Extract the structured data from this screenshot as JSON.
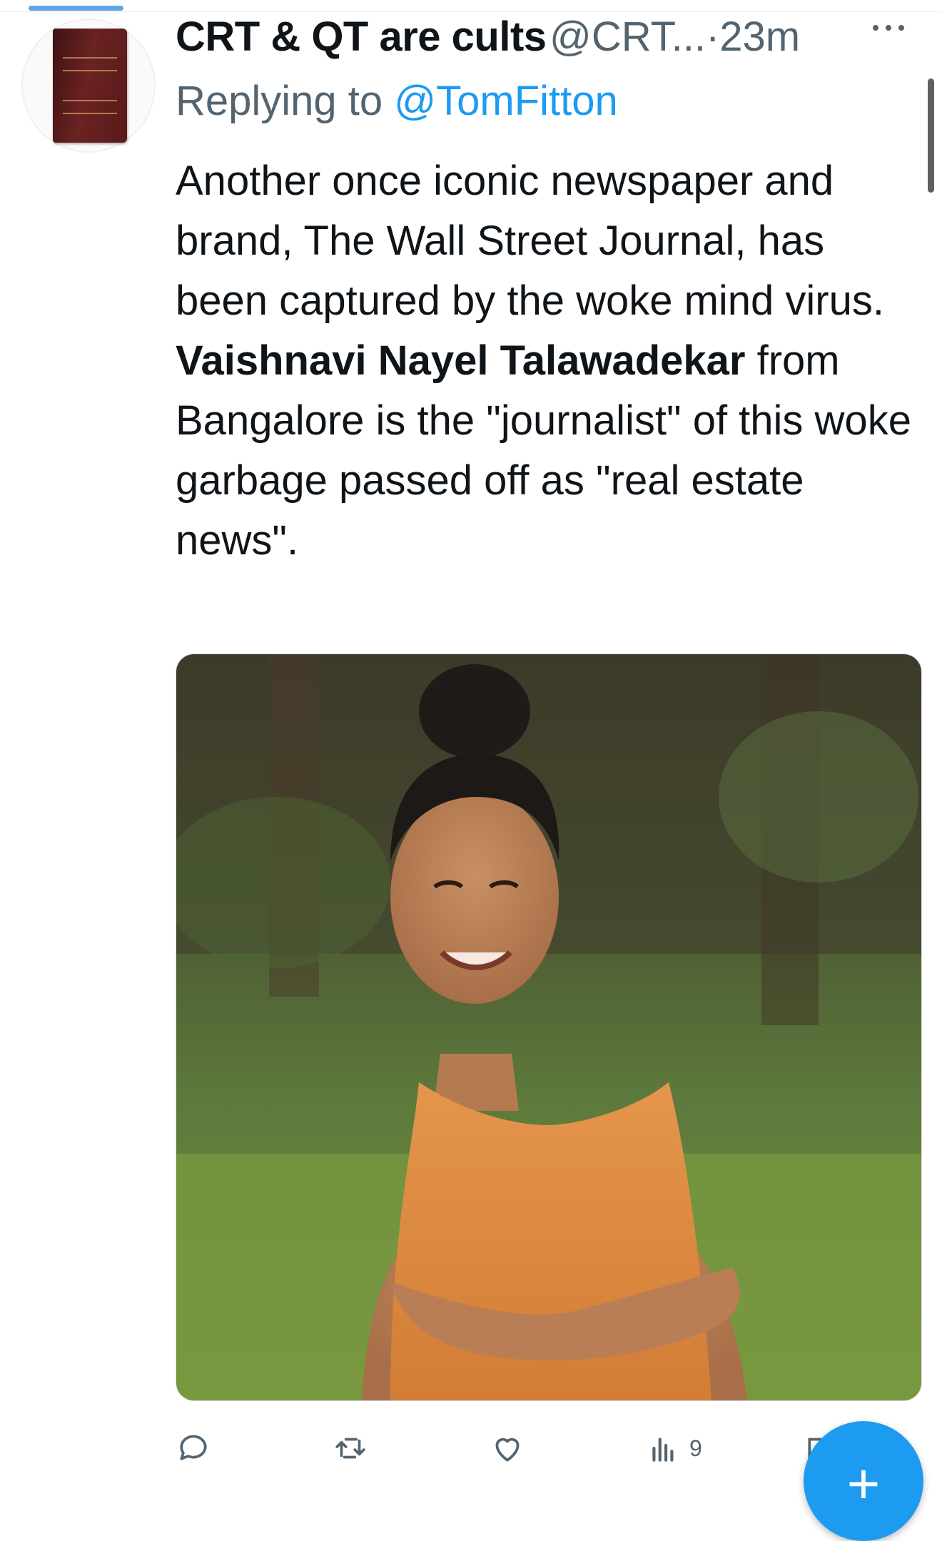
{
  "tweet": {
    "display_name": "CRT & QT are cults",
    "handle": "@CRT...",
    "separator": "·",
    "timestamp": "23m",
    "replying_label": "Replying to",
    "reply_to_handle": "@TomFitton",
    "body_part1": "Another once iconic newspaper and brand, The Wall Street Journal, has been captured by the woke mind virus.",
    "body_bold_name": "Vaishnavi Nayel Talawadekar",
    "body_part2": " from Bangalore is the \"journalist\" of this woke garbage passed off as \"real estate news\"."
  },
  "actions": {
    "reply_icon": "reply-icon",
    "retweet_icon": "retweet-icon",
    "like_icon": "like-icon",
    "views_icon": "views-icon",
    "views_count": "9",
    "share_icon": "share-icon"
  },
  "compose_button": {
    "label": "+",
    "color": "#1d9bf0"
  },
  "colors": {
    "accent": "#1d9bf0",
    "secondary_text": "#536471",
    "primary_text": "#0f1419"
  }
}
